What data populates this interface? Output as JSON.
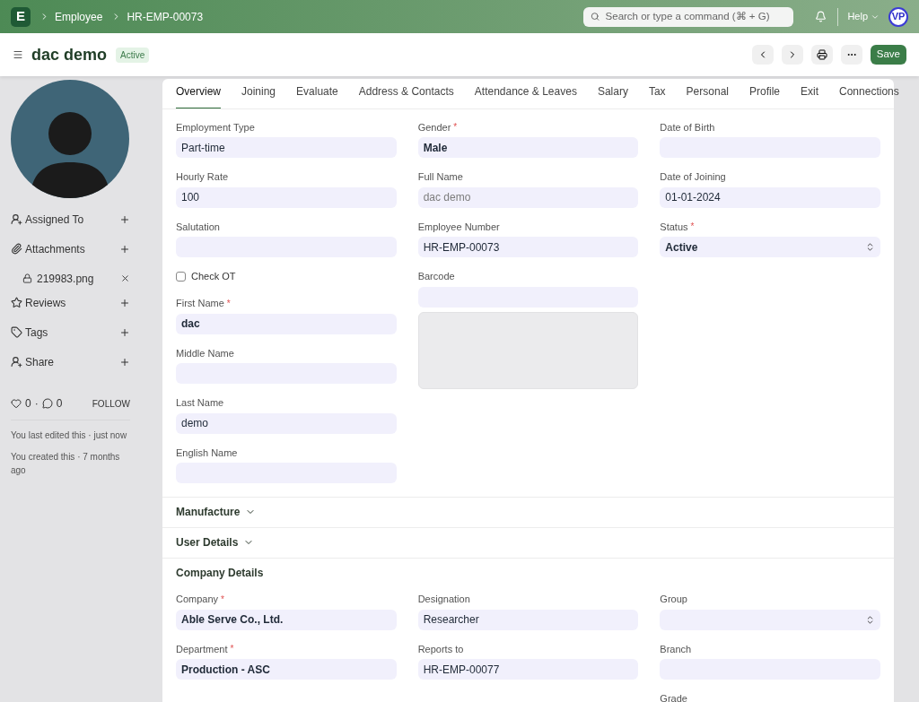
{
  "navbar": {
    "logo": "E",
    "breadcrumbs": [
      "Employee",
      "HR-EMP-00073"
    ],
    "search": {
      "placeholder": "Search or type a command (⌘ + G)"
    },
    "help": "Help",
    "avatar": "VP"
  },
  "header": {
    "title": "dac demo",
    "status": "Active",
    "save": "Save"
  },
  "required_mark": "*",
  "sidebar": {
    "items": [
      {
        "kind": "assign",
        "label": "Assigned To"
      },
      {
        "kind": "attach",
        "label": "Attachments"
      },
      {
        "kind": "file",
        "label": "219983.png"
      },
      {
        "kind": "review",
        "label": "Reviews"
      },
      {
        "kind": "tag",
        "label": "Tags"
      },
      {
        "kind": "share",
        "label": "Share"
      }
    ],
    "likes": "0",
    "separator": "·",
    "comments": "0",
    "follow": "FOLLOW",
    "timeline": [
      "You last edited this · just now",
      "You created this · 7 months ago"
    ]
  },
  "tabs": [
    {
      "label": "Overview",
      "selected": true
    },
    {
      "label": "Joining",
      "selected": false
    },
    {
      "label": "Evaluate",
      "selected": false
    },
    {
      "label": "Address & Contacts",
      "selected": false
    },
    {
      "label": "Attendance & Leaves",
      "selected": false
    },
    {
      "label": "Salary",
      "selected": false
    },
    {
      "label": "Tax",
      "selected": false
    },
    {
      "label": "Personal",
      "selected": false
    },
    {
      "label": "Profile",
      "selected": false
    },
    {
      "label": "Exit",
      "selected": false
    },
    {
      "label": "Connections",
      "selected": false
    }
  ],
  "overview": {
    "columns": [
      [
        {
          "kind": "input",
          "label": "Employment Type",
          "required": false,
          "value": "Part-time",
          "bold": false,
          "readonly": false
        },
        {
          "kind": "input",
          "label": "Hourly Rate",
          "required": false,
          "value": "100",
          "bold": false,
          "readonly": false
        },
        {
          "kind": "input",
          "label": "Salutation",
          "required": false
        },
        {
          "kind": "checkbox",
          "label": "Check OT",
          "checked": false
        },
        {
          "kind": "input",
          "label": "First Name",
          "required": true,
          "value": "dac",
          "bold": true,
          "readonly": false
        },
        {
          "kind": "input",
          "label": "Middle Name",
          "required": false
        },
        {
          "kind": "input",
          "label": "Last Name",
          "required": false,
          "value": "demo",
          "bold": false,
          "readonly": false
        },
        {
          "kind": "input",
          "label": "English Name",
          "required": false
        }
      ],
      [
        {
          "kind": "input",
          "label": "Gender",
          "required": true,
          "value": "Male",
          "bold": true,
          "readonly": false
        },
        {
          "kind": "input",
          "label": "Full Name",
          "required": false,
          "value": "dac demo",
          "bold": false,
          "readonly": true
        },
        {
          "kind": "input",
          "label": "Employee Number",
          "required": false,
          "value": "HR-EMP-00073",
          "bold": false,
          "readonly": false
        },
        {
          "kind": "barcode",
          "label": "Barcode",
          "required": false
        }
      ],
      [
        {
          "kind": "input",
          "label": "Date of Birth",
          "required": false
        },
        {
          "kind": "input",
          "label": "Date of Joining",
          "required": false,
          "value": "01-01-2024",
          "bold": false,
          "readonly": false
        },
        {
          "kind": "select",
          "label": "Status",
          "required": true,
          "value": "Active",
          "bold": true
        }
      ]
    ]
  },
  "sections": [
    {
      "title": "Manufacture",
      "expanded": false
    },
    {
      "title": "User Details",
      "expanded": false
    },
    {
      "title": "Company Details",
      "expanded": true,
      "columns": [
        [
          {
            "kind": "input",
            "label": "Company",
            "required": true,
            "value": "Able Serve Co., Ltd.",
            "bold": true,
            "readonly": false
          },
          {
            "kind": "input",
            "label": "Department",
            "required": true,
            "value": "Production - ASC",
            "bold": true,
            "readonly": false
          }
        ],
        [
          {
            "kind": "input",
            "label": "Designation",
            "required": false,
            "value": "Researcher",
            "bold": false,
            "readonly": false
          },
          {
            "kind": "input",
            "label": "Reports to",
            "required": false,
            "value": "HR-EMP-00077",
            "bold": false,
            "readonly": false
          }
        ],
        [
          {
            "kind": "select",
            "label": "Group",
            "required": false
          },
          {
            "kind": "input",
            "label": "Branch",
            "required": false
          },
          {
            "kind": "label",
            "label": "Grade",
            "required": false
          }
        ]
      ]
    }
  ]
}
